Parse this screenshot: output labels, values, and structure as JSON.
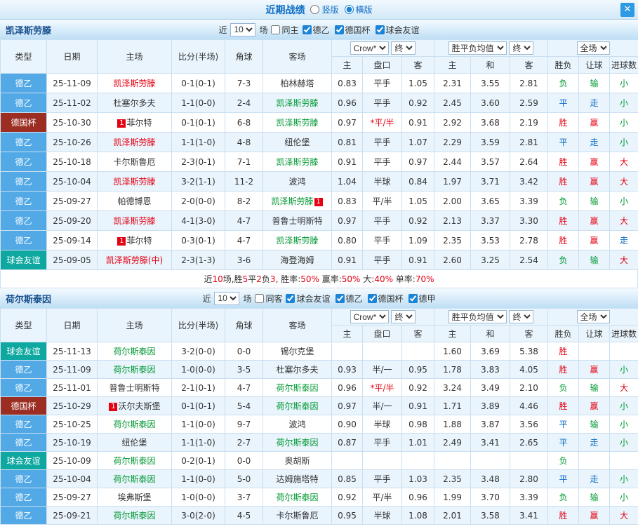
{
  "header": {
    "title": "近期战绩",
    "options": [
      {
        "label": "竖版",
        "checked": false
      },
      {
        "label": "横版",
        "checked": true
      }
    ],
    "close_label": "✕"
  },
  "table_headers": {
    "type": "类型",
    "date": "日期",
    "home": "主场",
    "score": "比分(半场)",
    "corner": "角球",
    "away": "客场",
    "odds_company": "Crow*",
    "final": "终",
    "avg_label": "胜平负均值",
    "full_label": "全场",
    "odds_home": "主",
    "handicap": "盘口",
    "odds_away": "客",
    "avg_home": "主",
    "avg_draw": "和",
    "avg_away": "客",
    "result": "胜负",
    "handicap_result": "让球",
    "goals_result": "进球数"
  },
  "maps": {
    "result_colors": {
      "胜": "red",
      "赢": "red",
      "大": "red",
      "负": "green",
      "输": "green",
      "小": "green",
      "平": "blue",
      "走": "blue"
    },
    "type_colors": {
      "德乙": "#52a9e6",
      "德甲": "#52a9e6",
      "德国杯": "#9b2d23",
      "球会友谊": "#0ea8a0"
    }
  },
  "sections": [
    {
      "team": "凯泽斯劳滕",
      "filter": {
        "near": "近",
        "count": "10",
        "games": "场",
        "same": "同主",
        "same_checked": false,
        "leagues": [
          {
            "label": "德乙",
            "checked": true
          },
          {
            "label": "德国杯",
            "checked": true
          },
          {
            "label": "球会友谊",
            "checked": true
          }
        ]
      },
      "rows": [
        {
          "type": "德乙",
          "date": "25-11-09",
          "home": "凯泽斯劳滕",
          "hc": "red",
          "hb": "",
          "score": "0-1(0-1)",
          "corner": "7-3",
          "away": "柏林赫塔",
          "ac": "",
          "ab": "",
          "o": [
            "0.83",
            "平手",
            "1.05"
          ],
          "m": [
            "2.31",
            "3.55",
            "2.81"
          ],
          "r": [
            "负",
            "输",
            "小"
          ]
        },
        {
          "type": "德乙",
          "date": "25-11-02",
          "home": "杜塞尔多夫",
          "hc": "",
          "hb": "",
          "score": "1-1(0-0)",
          "corner": "2-4",
          "away": "凯泽斯劳滕",
          "ac": "green",
          "ab": "",
          "o": [
            "0.96",
            "平手",
            "0.92"
          ],
          "m": [
            "2.45",
            "3.60",
            "2.59"
          ],
          "r": [
            "平",
            "走",
            "小"
          ]
        },
        {
          "type": "德国杯",
          "date": "25-10-30",
          "home": "菲尔特",
          "hc": "",
          "hb": "1",
          "score": "0-1(0-1)",
          "corner": "6-8",
          "away": "凯泽斯劳滕",
          "ac": "green",
          "ab": "",
          "o": [
            "0.97",
            "*平/半",
            "0.91"
          ],
          "m": [
            "2.92",
            "3.68",
            "2.19"
          ],
          "r": [
            "胜",
            "赢",
            "小"
          ]
        },
        {
          "type": "德乙",
          "date": "25-10-26",
          "home": "凯泽斯劳滕",
          "hc": "red",
          "hb": "",
          "score": "1-1(1-0)",
          "corner": "4-8",
          "away": "纽伦堡",
          "ac": "",
          "ab": "",
          "o": [
            "0.81",
            "平手",
            "1.07"
          ],
          "m": [
            "2.29",
            "3.59",
            "2.81"
          ],
          "r": [
            "平",
            "走",
            "小"
          ]
        },
        {
          "type": "德乙",
          "date": "25-10-18",
          "home": "卡尔斯鲁厄",
          "hc": "",
          "hb": "",
          "score": "2-3(0-1)",
          "corner": "7-1",
          "away": "凯泽斯劳滕",
          "ac": "green",
          "ab": "",
          "o": [
            "0.91",
            "平手",
            "0.97"
          ],
          "m": [
            "2.44",
            "3.57",
            "2.64"
          ],
          "r": [
            "胜",
            "赢",
            "大"
          ]
        },
        {
          "type": "德乙",
          "date": "25-10-04",
          "home": "凯泽斯劳滕",
          "hc": "red",
          "hb": "",
          "score": "3-2(1-1)",
          "corner": "11-2",
          "away": "波鸿",
          "ac": "",
          "ab": "",
          "o": [
            "1.04",
            "半球",
            "0.84"
          ],
          "m": [
            "1.97",
            "3.71",
            "3.42"
          ],
          "r": [
            "胜",
            "赢",
            "大"
          ]
        },
        {
          "type": "德乙",
          "date": "25-09-27",
          "home": "帕德博恩",
          "hc": "",
          "hb": "",
          "score": "2-0(0-0)",
          "corner": "8-2",
          "away": "凯泽斯劳滕",
          "ac": "green",
          "ab": "1",
          "o": [
            "0.83",
            "平/半",
            "1.05"
          ],
          "m": [
            "2.00",
            "3.65",
            "3.39"
          ],
          "r": [
            "负",
            "输",
            "小"
          ]
        },
        {
          "type": "德乙",
          "date": "25-09-20",
          "home": "凯泽斯劳滕",
          "hc": "red",
          "hb": "",
          "score": "4-1(3-0)",
          "corner": "4-7",
          "away": "普鲁士明斯特",
          "ac": "",
          "ab": "",
          "o": [
            "0.97",
            "平手",
            "0.92"
          ],
          "m": [
            "2.13",
            "3.37",
            "3.30"
          ],
          "r": [
            "胜",
            "赢",
            "大"
          ]
        },
        {
          "type": "德乙",
          "date": "25-09-14",
          "home": "菲尔特",
          "hc": "",
          "hb": "1",
          "score": "0-3(0-1)",
          "corner": "4-7",
          "away": "凯泽斯劳滕",
          "ac": "green",
          "ab": "",
          "o": [
            "0.80",
            "平手",
            "1.09"
          ],
          "m": [
            "2.35",
            "3.53",
            "2.78"
          ],
          "r": [
            "胜",
            "赢",
            "走"
          ]
        },
        {
          "type": "球会友谊",
          "date": "25-09-05",
          "home": "凯泽斯劳滕(中)",
          "hc": "red",
          "hb": "",
          "score": "2-3(1-3)",
          "corner": "3-6",
          "away": "海登海姆",
          "ac": "",
          "ab": "",
          "o": [
            "0.91",
            "平手",
            "0.91"
          ],
          "m": [
            "2.60",
            "3.25",
            "2.54"
          ],
          "r": [
            "负",
            "输",
            "大"
          ]
        }
      ],
      "summary": [
        {
          "t": "近"
        },
        {
          "t": "10",
          "c": "red"
        },
        {
          "t": "场,胜"
        },
        {
          "t": "5",
          "c": "red"
        },
        {
          "t": "平"
        },
        {
          "t": "2",
          "c": "red"
        },
        {
          "t": "负"
        },
        {
          "t": "3",
          "c": "red"
        },
        {
          "t": ", 胜率:"
        },
        {
          "t": "50%",
          "c": "red"
        },
        {
          "t": " 赢率:"
        },
        {
          "t": "50%",
          "c": "red"
        },
        {
          "t": " 大:"
        },
        {
          "t": "40%",
          "c": "red"
        },
        {
          "t": " 单率:"
        },
        {
          "t": "70%",
          "c": "red"
        }
      ]
    },
    {
      "team": "荷尔斯泰因",
      "filter": {
        "near": "近",
        "count": "10",
        "games": "场",
        "same": "同客",
        "same_checked": false,
        "leagues": [
          {
            "label": "球会友谊",
            "checked": true
          },
          {
            "label": "德乙",
            "checked": true
          },
          {
            "label": "德国杯",
            "checked": true
          },
          {
            "label": "德甲",
            "checked": true
          }
        ]
      },
      "rows": [
        {
          "type": "球会友谊",
          "date": "25-11-13",
          "home": "荷尔斯泰因",
          "hc": "green",
          "hb": "",
          "score": "3-2(0-0)",
          "corner": "0-0",
          "away": "锡尔克堡",
          "ac": "",
          "ab": "",
          "o": [
            "",
            "",
            ""
          ],
          "m": [
            "1.60",
            "3.69",
            "5.38"
          ],
          "r": [
            "胜",
            "",
            ""
          ]
        },
        {
          "type": "德乙",
          "date": "25-11-09",
          "home": "荷尔斯泰因",
          "hc": "green",
          "hb": "",
          "score": "1-0(0-0)",
          "corner": "3-5",
          "away": "杜塞尔多夫",
          "ac": "",
          "ab": "",
          "o": [
            "0.93",
            "半/一",
            "0.95"
          ],
          "m": [
            "1.78",
            "3.83",
            "4.05"
          ],
          "r": [
            "胜",
            "赢",
            "小"
          ]
        },
        {
          "type": "德乙",
          "date": "25-11-01",
          "home": "普鲁士明斯特",
          "hc": "",
          "hb": "",
          "score": "2-1(0-1)",
          "corner": "4-7",
          "away": "荷尔斯泰因",
          "ac": "green",
          "ab": "",
          "o": [
            "0.96",
            "*平/半",
            "0.92"
          ],
          "m": [
            "3.24",
            "3.49",
            "2.10"
          ],
          "r": [
            "负",
            "输",
            "大"
          ]
        },
        {
          "type": "德国杯",
          "date": "25-10-29",
          "home": "沃尔夫斯堡",
          "hc": "",
          "hb": "1",
          "score": "0-1(0-1)",
          "corner": "5-4",
          "away": "荷尔斯泰因",
          "ac": "green",
          "ab": "",
          "o": [
            "0.97",
            "半/一",
            "0.91"
          ],
          "m": [
            "1.71",
            "3.89",
            "4.46"
          ],
          "r": [
            "胜",
            "赢",
            "小"
          ]
        },
        {
          "type": "德乙",
          "date": "25-10-25",
          "home": "荷尔斯泰因",
          "hc": "green",
          "hb": "",
          "score": "1-1(0-0)",
          "corner": "9-7",
          "away": "波鸿",
          "ac": "",
          "ab": "",
          "o": [
            "0.90",
            "半球",
            "0.98"
          ],
          "m": [
            "1.88",
            "3.87",
            "3.56"
          ],
          "r": [
            "平",
            "输",
            "小"
          ]
        },
        {
          "type": "德乙",
          "date": "25-10-19",
          "home": "纽伦堡",
          "hc": "",
          "hb": "",
          "score": "1-1(1-0)",
          "corner": "2-7",
          "away": "荷尔斯泰因",
          "ac": "green",
          "ab": "",
          "o": [
            "0.87",
            "平手",
            "1.01"
          ],
          "m": [
            "2.49",
            "3.41",
            "2.65"
          ],
          "r": [
            "平",
            "走",
            "小"
          ]
        },
        {
          "type": "球会友谊",
          "date": "25-10-09",
          "home": "荷尔斯泰因",
          "hc": "green",
          "hb": "",
          "score": "0-2(0-1)",
          "corner": "0-0",
          "away": "奥胡斯",
          "ac": "",
          "ab": "",
          "o": [
            "",
            "",
            ""
          ],
          "m": [
            "",
            "",
            ""
          ],
          "r": [
            "负",
            "",
            ""
          ]
        },
        {
          "type": "德乙",
          "date": "25-10-04",
          "home": "荷尔斯泰因",
          "hc": "green",
          "hb": "",
          "score": "1-1(0-0)",
          "corner": "5-0",
          "away": "达姆施塔特",
          "ac": "",
          "ab": "",
          "o": [
            "0.85",
            "平手",
            "1.03"
          ],
          "m": [
            "2.35",
            "3.48",
            "2.80"
          ],
          "r": [
            "平",
            "走",
            "小"
          ]
        },
        {
          "type": "德乙",
          "date": "25-09-27",
          "home": "埃弗斯堡",
          "hc": "",
          "hb": "",
          "score": "1-0(0-0)",
          "corner": "3-7",
          "away": "荷尔斯泰因",
          "ac": "green",
          "ab": "",
          "o": [
            "0.92",
            "平/半",
            "0.96"
          ],
          "m": [
            "1.99",
            "3.70",
            "3.39"
          ],
          "r": [
            "负",
            "输",
            "小"
          ]
        },
        {
          "type": "德乙",
          "date": "25-09-21",
          "home": "荷尔斯泰因",
          "hc": "green",
          "hb": "",
          "score": "3-0(2-0)",
          "corner": "4-5",
          "away": "卡尔斯鲁厄",
          "ac": "",
          "ab": "",
          "o": [
            "0.95",
            "半球",
            "1.08"
          ],
          "m": [
            "2.01",
            "3.58",
            "3.41"
          ],
          "r": [
            "胜",
            "赢",
            "大"
          ]
        }
      ]
    }
  ]
}
